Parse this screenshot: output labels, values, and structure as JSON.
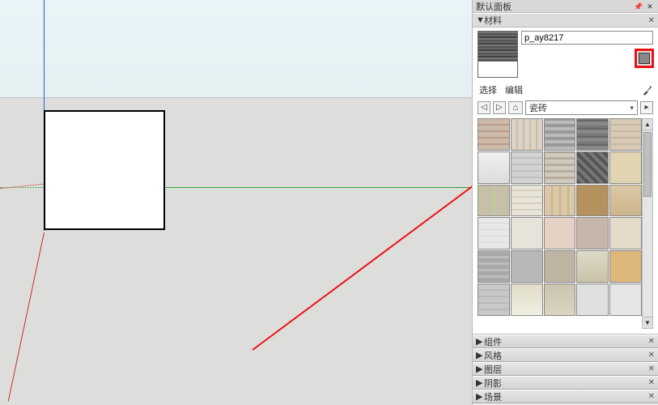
{
  "window": {
    "title": "默认面板",
    "pin": "📌",
    "close": "✕"
  },
  "sections": {
    "materials": {
      "label": "材料",
      "expanded": true,
      "close": "✕"
    },
    "components": {
      "label": "组件",
      "close": "✕"
    },
    "styles": {
      "label": "风格",
      "close": "✕"
    },
    "layers": {
      "label": "图层",
      "close": "✕"
    },
    "shadows": {
      "label": "阴影",
      "close": "✕"
    },
    "scenes": {
      "label": "场景",
      "close": "✕"
    }
  },
  "materials": {
    "name_value": "p_ay8217",
    "tabs": {
      "select": "选择",
      "edit": "编辑"
    },
    "nav": {
      "back": "◁",
      "forward": "▷",
      "home": "⌂",
      "category": "瓷砖",
      "menu": "▸"
    },
    "scroll": {
      "up": "▲",
      "down": "▼"
    }
  }
}
